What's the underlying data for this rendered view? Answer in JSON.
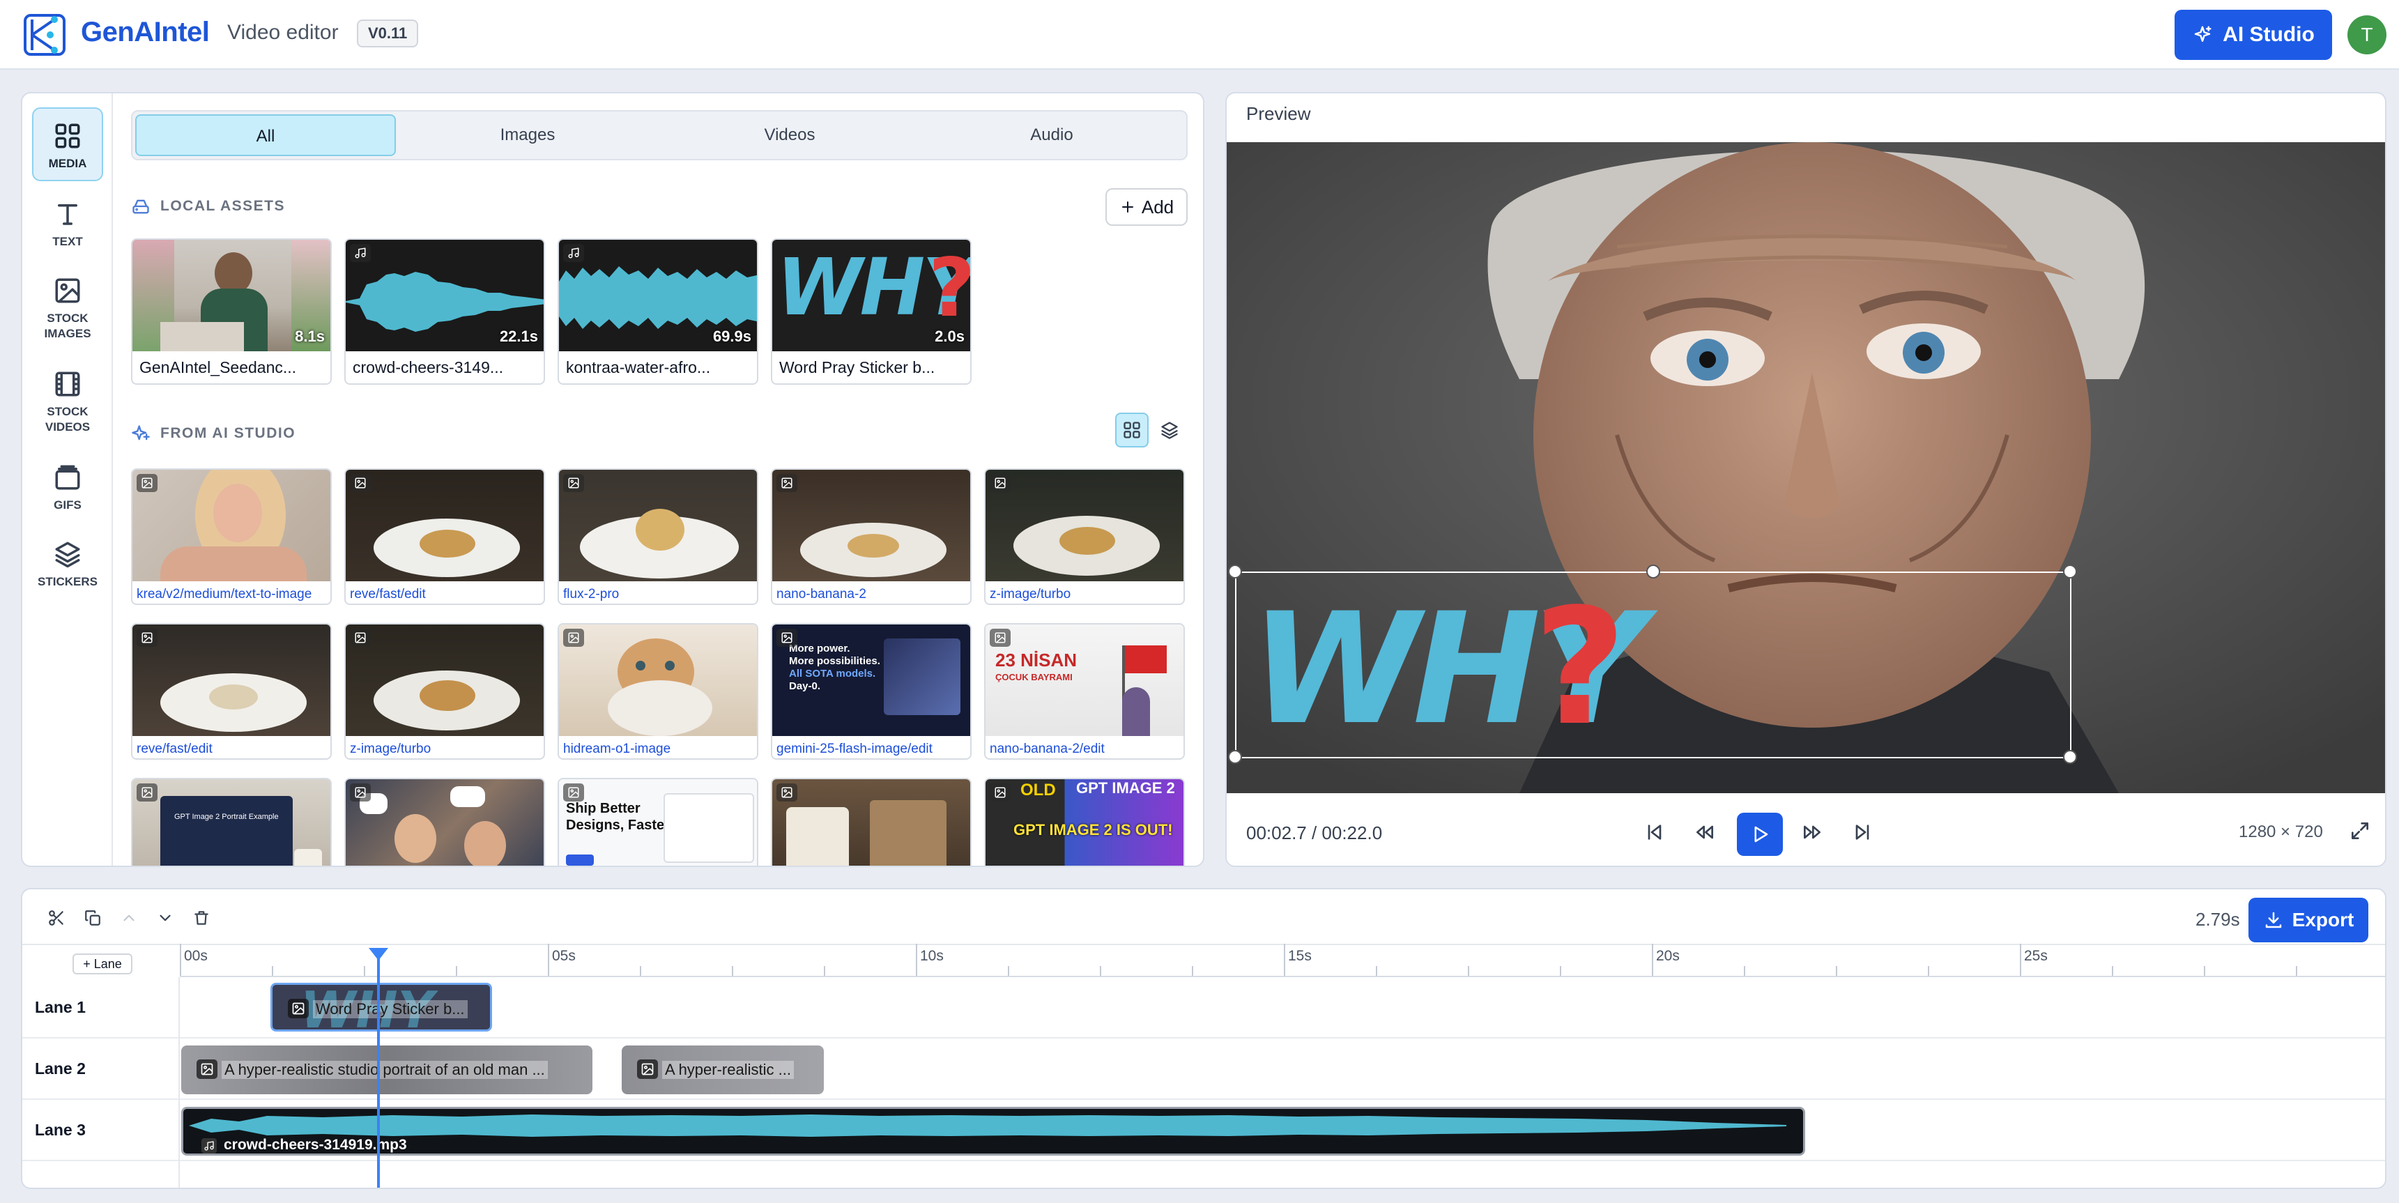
{
  "header": {
    "brand": "GenAIntel",
    "subtitle": "Video editor",
    "version": "V0.11",
    "ai_studio_label": "AI Studio",
    "avatar_initial": "T",
    "accent": "#1d5be6"
  },
  "rail": [
    {
      "label": "MEDIA",
      "icon": "grid-icon"
    },
    {
      "label": "TEXT",
      "icon": "text-icon"
    },
    {
      "label": "STOCK IMAGES",
      "icon": "image-icon"
    },
    {
      "label": "STOCK VIDEOS",
      "icon": "film-icon"
    },
    {
      "label": "GIFS",
      "icon": "gif-icon"
    },
    {
      "label": "STICKERS",
      "icon": "layers-icon"
    }
  ],
  "media_tabs": [
    "All",
    "Images",
    "Videos",
    "Audio"
  ],
  "local_assets": {
    "heading": "LOCAL ASSETS",
    "add_label": "Add",
    "items": [
      {
        "name": "GenAIntel_Seedanc...",
        "duration": "8.1s"
      },
      {
        "name": "crowd-cheers-3149...",
        "duration": "22.1s"
      },
      {
        "name": "kontraa-water-afro...",
        "duration": "69.9s"
      },
      {
        "name": "Word Pray Sticker b...",
        "duration": "2.0s"
      }
    ]
  },
  "ai_studio": {
    "heading": "FROM AI STUDIO",
    "items": [
      {
        "label": "krea/v2/medium/text-to-image"
      },
      {
        "label": "reve/fast/edit"
      },
      {
        "label": "flux-2-pro"
      },
      {
        "label": "nano-banana-2"
      },
      {
        "label": "z-image/turbo"
      },
      {
        "label": "reve/fast/edit"
      },
      {
        "label": "z-image/turbo"
      },
      {
        "label": "hidream-o1-image"
      },
      {
        "label": "gemini-25-flash-image/edit"
      },
      {
        "label": "nano-banana-2/edit"
      }
    ],
    "thumb_texts": {
      "gemini_l1": "More power.",
      "gemini_l2": "More possibilities.",
      "gemini_l3": "All SOTA models.",
      "gemini_l4": "Day-0.",
      "nisan_l1": "23 NİSAN",
      "nisan_l2": "ÇOCUK BAYRAMI",
      "ship_l1": "Ship Better",
      "ship_l2": "Designs, Faster.",
      "gpt_l1": "OLD",
      "gpt_l2": "GPT IMAGE 2",
      "gpt_l3": "GPT IMAGE 2 IS OUT!",
      "laptop_l1": "GPT Image 2 Portrait Example"
    }
  },
  "preview": {
    "title": "Preview",
    "sticker_text": "WHY",
    "sticker_mark": "?",
    "timecode": "00:02.7 / 00:22.0",
    "resolution": "1280 × 720"
  },
  "timeline": {
    "zoom_label": "2.79s",
    "export_label": "Export",
    "add_lane_label": "+ Lane",
    "ticks": [
      "00s",
      "05s",
      "10s",
      "15s",
      "20s",
      "25s"
    ],
    "lanes": [
      "Lane 1",
      "Lane 2",
      "Lane 3"
    ],
    "clips": {
      "lane1_clip": "Word Pray Sticker b...",
      "lane2_clip_a": "A hyper-realistic studio portrait of an old man ...",
      "lane2_clip_b": "A hyper-realistic ...",
      "lane3_clip": "crowd-cheers-314919.mp3"
    },
    "playhead_time_s": 2.7,
    "total_s": 22.0
  }
}
